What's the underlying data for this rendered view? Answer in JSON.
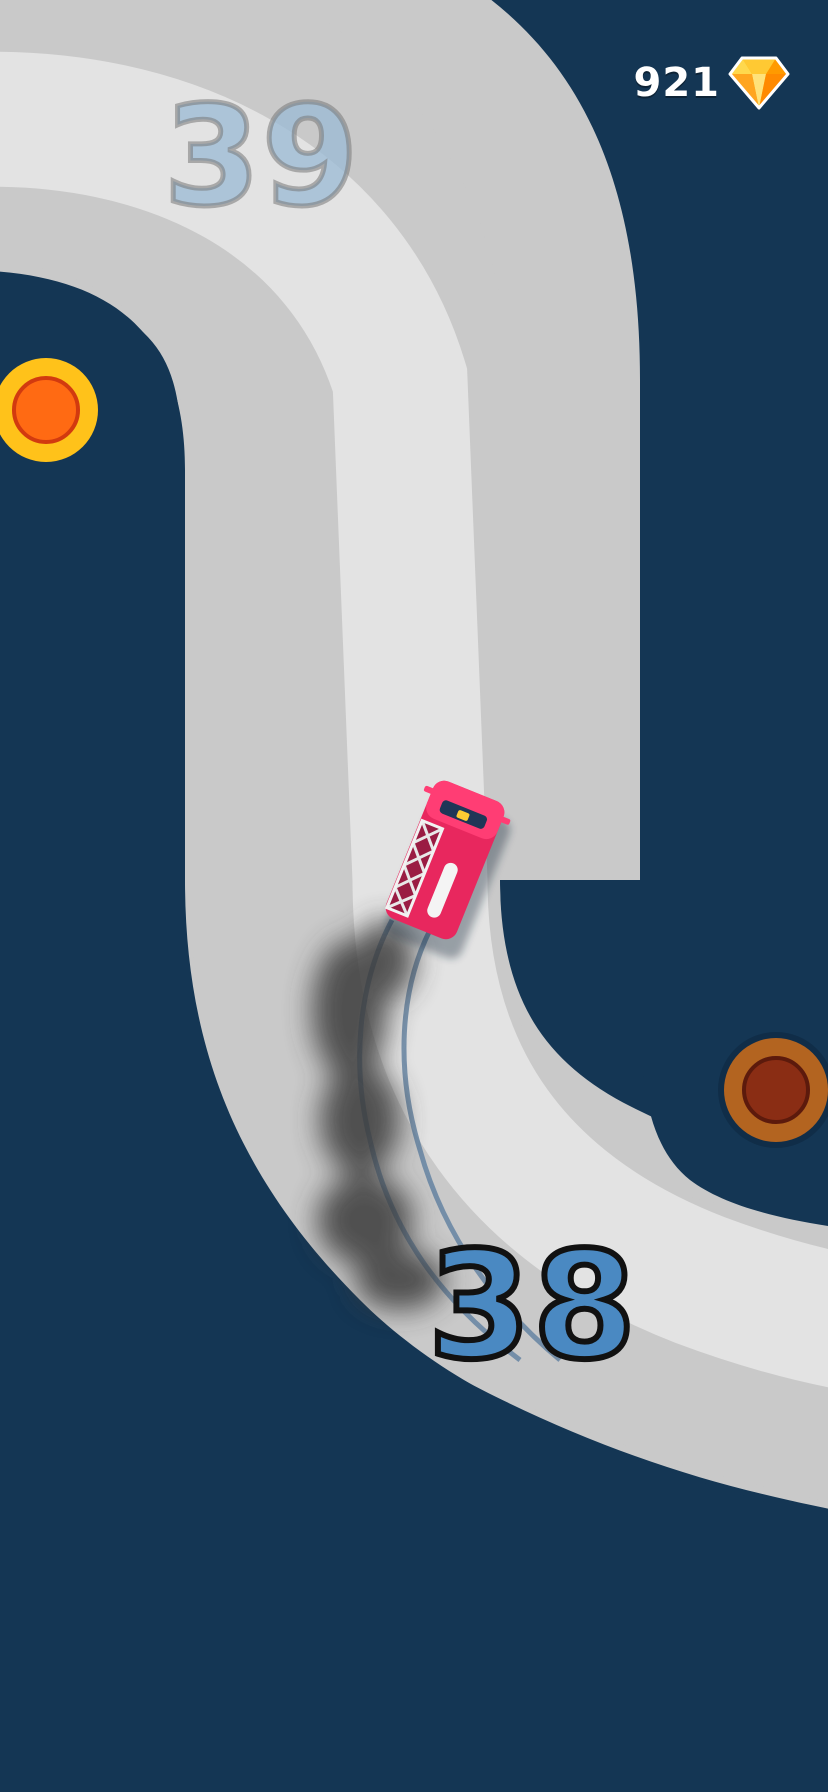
{
  "hud": {
    "gem_count": "921",
    "gem_icon": "diamond-icon"
  },
  "track": {
    "next_segment_number": "39",
    "current_segment_number": "38"
  },
  "colors": {
    "background": "#143654",
    "track_outer": "#c9c9c9",
    "track_inner": "#e3e3e3",
    "car": "#e8275e",
    "pivot_active": "#ffc21a",
    "pivot_inactive": "#7a3a1c",
    "current_number": "#4a89c2"
  }
}
